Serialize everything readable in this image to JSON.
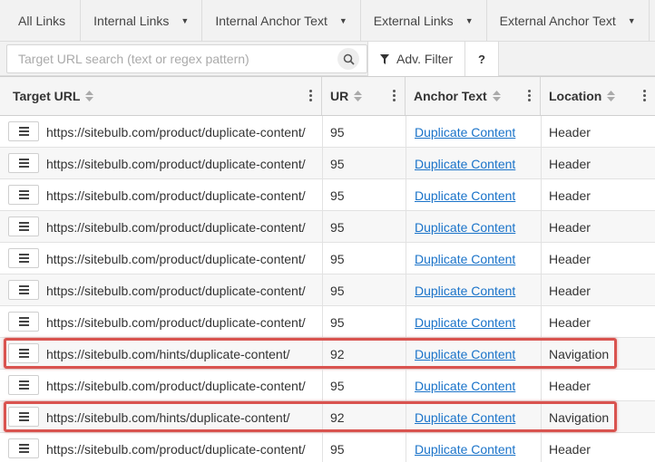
{
  "tabs": [
    {
      "label": "All Links",
      "has_caret": false
    },
    {
      "label": "Internal Links",
      "has_caret": true
    },
    {
      "label": "Internal Anchor Text",
      "has_caret": true
    },
    {
      "label": "External Links",
      "has_caret": true
    },
    {
      "label": "External Anchor Text",
      "has_caret": true
    }
  ],
  "search": {
    "placeholder": "Target URL search (text or regex pattern)",
    "value": ""
  },
  "toolbar": {
    "adv_filter_label": "Adv. Filter",
    "help_label": "?"
  },
  "table": {
    "columns": [
      "Target URL",
      "UR",
      "Anchor Text",
      "Location"
    ],
    "rows": [
      {
        "url": "https://sitebulb.com/product/duplicate-content/",
        "ur": "95",
        "anchor": "Duplicate Content",
        "location": "Header",
        "highlighted": false
      },
      {
        "url": "https://sitebulb.com/product/duplicate-content/",
        "ur": "95",
        "anchor": "Duplicate Content",
        "location": "Header",
        "highlighted": false
      },
      {
        "url": "https://sitebulb.com/product/duplicate-content/",
        "ur": "95",
        "anchor": "Duplicate Content",
        "location": "Header",
        "highlighted": false
      },
      {
        "url": "https://sitebulb.com/product/duplicate-content/",
        "ur": "95",
        "anchor": "Duplicate Content",
        "location": "Header",
        "highlighted": false
      },
      {
        "url": "https://sitebulb.com/product/duplicate-content/",
        "ur": "95",
        "anchor": "Duplicate Content",
        "location": "Header",
        "highlighted": false
      },
      {
        "url": "https://sitebulb.com/product/duplicate-content/",
        "ur": "95",
        "anchor": "Duplicate Content",
        "location": "Header",
        "highlighted": false
      },
      {
        "url": "https://sitebulb.com/product/duplicate-content/",
        "ur": "95",
        "anchor": "Duplicate Content",
        "location": "Header",
        "highlighted": false
      },
      {
        "url": "https://sitebulb.com/hints/duplicate-content/",
        "ur": "92",
        "anchor": "Duplicate Content",
        "location": "Navigation",
        "highlighted": true
      },
      {
        "url": "https://sitebulb.com/product/duplicate-content/",
        "ur": "95",
        "anchor": "Duplicate Content",
        "location": "Header",
        "highlighted": false
      },
      {
        "url": "https://sitebulb.com/hints/duplicate-content/",
        "ur": "92",
        "anchor": "Duplicate Content",
        "location": "Navigation",
        "highlighted": true
      },
      {
        "url": "https://sitebulb.com/product/duplicate-content/",
        "ur": "95",
        "anchor": "Duplicate Content",
        "location": "Header",
        "highlighted": false
      }
    ]
  },
  "colors": {
    "link": "#1a73c9",
    "highlight": "#d9534f"
  }
}
